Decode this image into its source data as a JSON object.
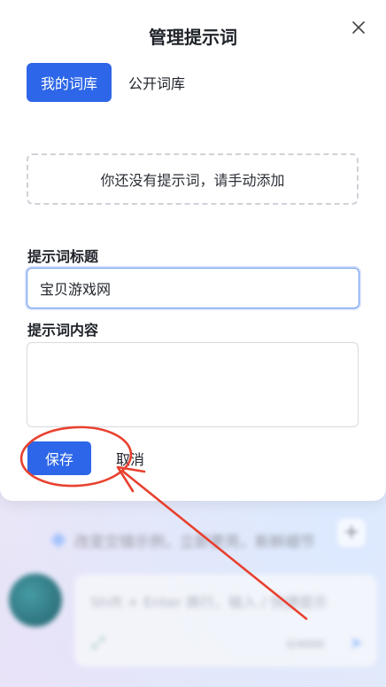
{
  "modal": {
    "title": "管理提示词",
    "tabs": [
      {
        "label": "我的词库",
        "active": true
      },
      {
        "label": "公开词库",
        "active": false
      }
    ],
    "empty_message": "你还没有提示词，请手动添加",
    "title_field": {
      "label": "提示词标题",
      "value": "宝贝游戏网"
    },
    "content_field": {
      "label": "提示词内容",
      "value": ""
    },
    "save_label": "保存",
    "cancel_label": "取消",
    "close_icon": "close-icon"
  },
  "background": {
    "hint_text": "改变交错示例，立即更亮，新鲜细节",
    "input_placeholder": "Shift + Enter 换行，输入 / 快捷提示",
    "input_count": "0/4000",
    "plus_label": "+"
  },
  "annotation": {
    "color": "#e8412f",
    "shape": "ellipse-and-arrow",
    "target": "save-button"
  },
  "colors": {
    "primary": "#2d66e8",
    "text": "#1f2329",
    "border_dashed": "#cfd2d8",
    "focus_border": "#6a98ef"
  }
}
